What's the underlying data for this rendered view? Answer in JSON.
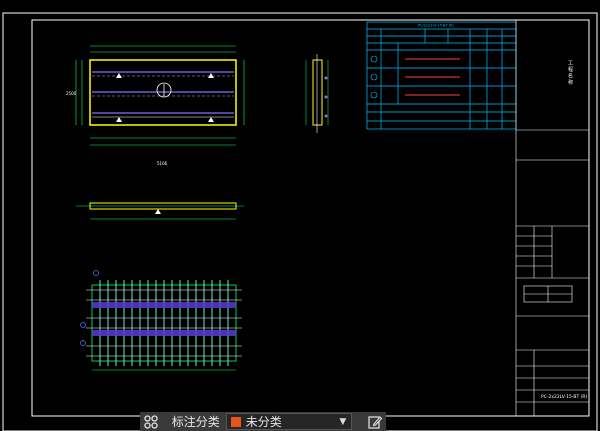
{
  "drawing": {
    "table_title": "PC/2x22LV-15-BT (R)",
    "title_block_vertical": "工 程 名 称",
    "drawing_number": "PC-2x22LV-15-BT (R)",
    "dim_width": "5166",
    "dim_height": "2500",
    "scale_label": "1:5"
  },
  "toolbar": {
    "category_label": "标注分类",
    "selected_value": "未分类",
    "swatch_color": "#e8541c"
  },
  "icons": {
    "grid": "grid-icon",
    "dropdown": "chevron-down-icon",
    "edit": "edit-icon"
  }
}
